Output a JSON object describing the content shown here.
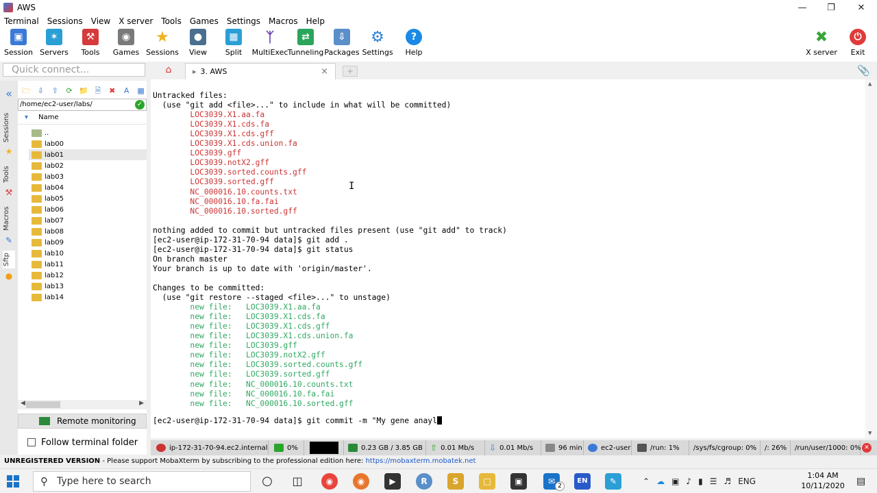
{
  "window": {
    "title": "AWS"
  },
  "menu": [
    "Terminal",
    "Sessions",
    "View",
    "X server",
    "Tools",
    "Games",
    "Settings",
    "Macros",
    "Help"
  ],
  "toolbar": {
    "items": [
      {
        "label": "Session",
        "icon": "session-icon",
        "color": "#3b79d6"
      },
      {
        "label": "Servers",
        "icon": "servers-icon",
        "color": "#2a9fd6"
      },
      {
        "label": "Tools",
        "icon": "tools-icon",
        "color": "#d63b3b"
      },
      {
        "label": "Games",
        "icon": "games-icon",
        "color": "#7a7a7a"
      },
      {
        "label": "Sessions",
        "icon": "star-icon",
        "color": "#f1b31c"
      },
      {
        "label": "View",
        "icon": "view-icon",
        "color": "#4b6f8f"
      },
      {
        "label": "Split",
        "icon": "split-icon",
        "color": "#2a9fd6"
      },
      {
        "label": "MultiExec",
        "icon": "multiexec-icon",
        "color": "#6a3cb5"
      },
      {
        "label": "Tunneling",
        "icon": "tunneling-icon",
        "color": "#2aa55b"
      },
      {
        "label": "Packages",
        "icon": "packages-icon",
        "color": "#5a8fc9"
      },
      {
        "label": "Settings",
        "icon": "settings-icon",
        "color": "#2a7fd6"
      },
      {
        "label": "Help",
        "icon": "help-icon",
        "color": "#1a8ae6"
      }
    ],
    "right": [
      {
        "label": "X server",
        "icon": "x-server-icon",
        "color": "#3aa53a"
      },
      {
        "label": "Exit",
        "icon": "power-icon",
        "color": "#e03a3a"
      }
    ]
  },
  "quick_connect": {
    "placeholder": "Quick connect..."
  },
  "tabs": [
    {
      "label": "3. AWS"
    }
  ],
  "sidebar": {
    "vertical_tabs": [
      "Sessions",
      "Tools",
      "Macros",
      "Sftp"
    ],
    "path": "/home/ec2-user/labs/",
    "column_header": "Name",
    "items": [
      {
        "label": ".."
      },
      {
        "label": "lab00"
      },
      {
        "label": "lab01"
      },
      {
        "label": "lab02"
      },
      {
        "label": "lab03"
      },
      {
        "label": "lab04"
      },
      {
        "label": "lab05"
      },
      {
        "label": "lab06"
      },
      {
        "label": "lab07"
      },
      {
        "label": "lab08"
      },
      {
        "label": "lab09"
      },
      {
        "label": "lab10"
      },
      {
        "label": "lab11"
      },
      {
        "label": "lab12"
      },
      {
        "label": "lab13"
      },
      {
        "label": "lab14"
      }
    ],
    "remote_monitoring": "Remote monitoring",
    "follow_folder": "Follow terminal folder"
  },
  "terminal": {
    "lines": [
      {
        "text": "Untracked files:",
        "color": "plain"
      },
      {
        "text": "  (use \"git add <file>...\" to include in what will be committed)",
        "color": "plain"
      },
      {
        "text": "        LOC3039.X1.aa.fa",
        "color": "red"
      },
      {
        "text": "        LOC3039.X1.cds.fa",
        "color": "red"
      },
      {
        "text": "        LOC3039.X1.cds.gff",
        "color": "red"
      },
      {
        "text": "        LOC3039.X1.cds.union.fa",
        "color": "red"
      },
      {
        "text": "        LOC3039.gff",
        "color": "red"
      },
      {
        "text": "        LOC3039.notX2.gff",
        "color": "red"
      },
      {
        "text": "        LOC3039.sorted.counts.gff",
        "color": "red"
      },
      {
        "text": "        LOC3039.sorted.gff",
        "color": "red"
      },
      {
        "text": "        NC_000016.10.counts.txt",
        "color": "red"
      },
      {
        "text": "        NC_000016.10.fa.fai",
        "color": "red"
      },
      {
        "text": "        NC_000016.10.sorted.gff",
        "color": "red"
      },
      {
        "text": "",
        "color": "plain"
      },
      {
        "text": "nothing added to commit but untracked files present (use \"git add\" to track)",
        "color": "plain"
      },
      {
        "text": "[ec2-user@ip-172-31-70-94 data]$ git add .",
        "color": "plain"
      },
      {
        "text": "[ec2-user@ip-172-31-70-94 data]$ git status",
        "color": "plain"
      },
      {
        "text": "On branch master",
        "color": "plain"
      },
      {
        "text": "Your branch is up to date with 'origin/master'.",
        "color": "plain"
      },
      {
        "text": "",
        "color": "plain"
      },
      {
        "text": "Changes to be committed:",
        "color": "plain"
      },
      {
        "text": "  (use \"git restore --staged <file>...\" to unstage)",
        "color": "plain"
      },
      {
        "text": "        new file:   LOC3039.X1.aa.fa",
        "color": "grn"
      },
      {
        "text": "        new file:   LOC3039.X1.cds.fa",
        "color": "grn"
      },
      {
        "text": "        new file:   LOC3039.X1.cds.gff",
        "color": "grn"
      },
      {
        "text": "        new file:   LOC3039.X1.cds.union.fa",
        "color": "grn"
      },
      {
        "text": "        new file:   LOC3039.gff",
        "color": "grn"
      },
      {
        "text": "        new file:   LOC3039.notX2.gff",
        "color": "grn"
      },
      {
        "text": "        new file:   LOC3039.sorted.counts.gff",
        "color": "grn"
      },
      {
        "text": "        new file:   LOC3039.sorted.gff",
        "color": "grn"
      },
      {
        "text": "        new file:   NC_000016.10.counts.txt",
        "color": "grn"
      },
      {
        "text": "        new file:   NC_000016.10.fa.fai",
        "color": "grn"
      },
      {
        "text": "        new file:   NC_000016.10.sorted.gff",
        "color": "grn"
      },
      {
        "text": "",
        "color": "plain"
      },
      {
        "text": "[ec2-user@ip-172-31-70-94 data]$ git commit -m \"My gene anayl",
        "color": "plain"
      }
    ]
  },
  "status": {
    "host": "ip-172-31-70-94.ec2.internal",
    "cpu": "0%",
    "memory": "0.23 GB / 3.85 GB",
    "upload": "0.01 Mb/s",
    "download": "0.01 Mb/s",
    "uptime": "96 min",
    "user": "ec2-user",
    "run": "/run: 1%",
    "cgroup": "/sys/fs/cgroup: 0%",
    "root": "/: 26%",
    "runuser": "/run/user/1000: 0%"
  },
  "unregistered": {
    "label": "UNREGISTERED VERSION",
    "message": "  -  Please support MobaXterm by subscribing to the professional edition here:",
    "link": "https://mobaxterm.mobatek.net"
  },
  "taskbar": {
    "search_placeholder": "Type here to search",
    "lang": "ENG",
    "ime": "EN",
    "mail_badge": "2",
    "time": "1:04 AM",
    "date": "10/11/2020"
  }
}
